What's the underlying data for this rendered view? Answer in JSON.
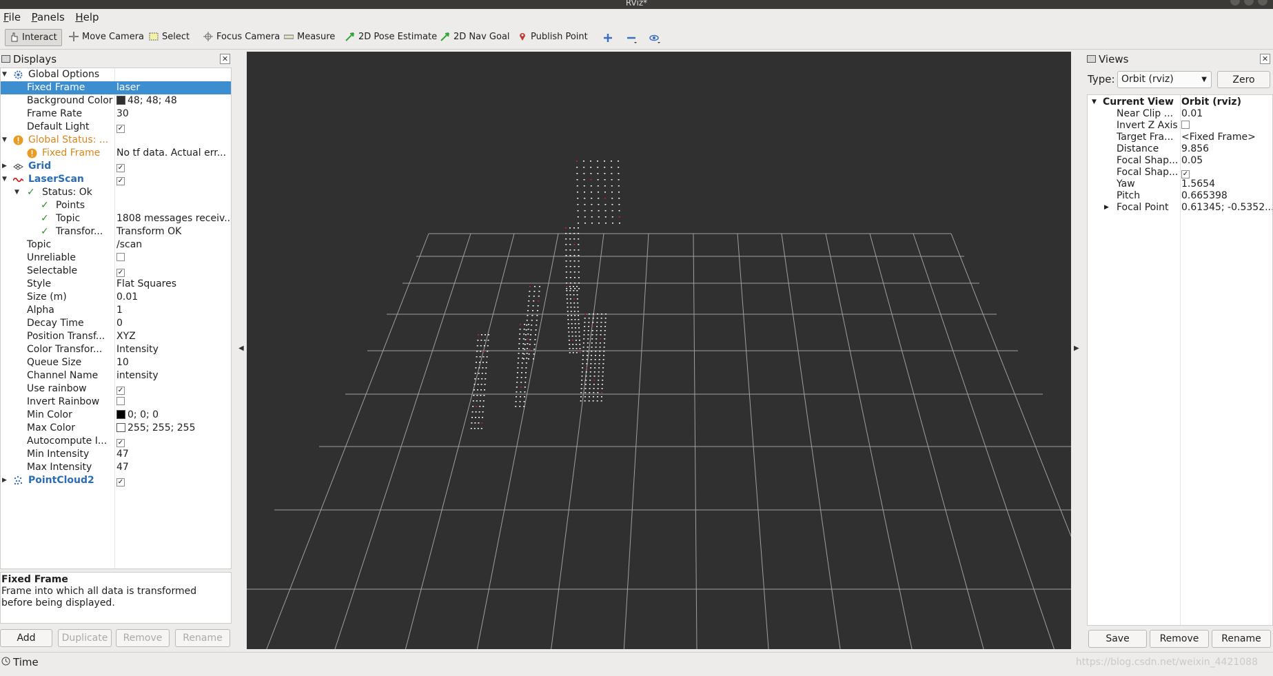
{
  "window": {
    "title": "RViz*"
  },
  "menu": [
    "File",
    "Panels",
    "Help"
  ],
  "toolbar": {
    "interact": "Interact",
    "move_camera": "Move Camera",
    "select": "Select",
    "focus_camera": "Focus Camera",
    "measure": "Measure",
    "pose_estimate": "2D Pose Estimate",
    "nav_goal": "2D Nav Goal",
    "publish_point": "Publish Point"
  },
  "displays": {
    "title": "Displays",
    "rows": {
      "global_options": "Global Options",
      "fixed_frame_k": "Fixed Frame",
      "fixed_frame_v": "laser",
      "bg_color_k": "Background Color",
      "bg_color_v": "48; 48; 48",
      "frame_rate_k": "Frame Rate",
      "frame_rate_v": "30",
      "default_light_k": "Default Light",
      "global_status_k": "Global Status: ...",
      "gs_fixed_frame_k": "Fixed Frame",
      "gs_fixed_frame_v": "No tf data.  Actual err...",
      "grid_k": "Grid",
      "laserscan_k": "LaserScan",
      "status_ok_k": "Status: Ok",
      "points_k": "Points",
      "topic_status_k": "Topic",
      "topic_status_v": "1808 messages receiv...",
      "transform_k": "Transfor...",
      "transform_v": "Transform OK",
      "topic_k": "Topic",
      "topic_v": "/scan",
      "unreliable_k": "Unreliable",
      "selectable_k": "Selectable",
      "style_k": "Style",
      "style_v": "Flat Squares",
      "size_k": "Size (m)",
      "size_v": "0.01",
      "alpha_k": "Alpha",
      "alpha_v": "1",
      "decay_k": "Decay Time",
      "decay_v": "0",
      "pos_transf_k": "Position Transf...",
      "pos_transf_v": "XYZ",
      "color_transf_k": "Color Transfor...",
      "color_transf_v": "Intensity",
      "queue_k": "Queue Size",
      "queue_v": "10",
      "channel_k": "Channel Name",
      "channel_v": "intensity",
      "use_rainbow_k": "Use rainbow",
      "invert_rainbow_k": "Invert Rainbow",
      "min_color_k": "Min Color",
      "min_color_v": "0; 0; 0",
      "max_color_k": "Max Color",
      "max_color_v": "255; 255; 255",
      "autocompute_k": "Autocompute I...",
      "min_int_k": "Min Intensity",
      "min_int_v": "47",
      "max_int_k": "Max Intensity",
      "max_int_v": "47",
      "pointcloud_k": "PointCloud2"
    },
    "description": {
      "title": "Fixed Frame",
      "text": "Frame into which all data is transformed before being displayed."
    },
    "buttons": {
      "add": "Add",
      "duplicate": "Duplicate",
      "remove": "Remove",
      "rename": "Rename"
    }
  },
  "views": {
    "title": "Views",
    "type_label": "Type:",
    "type_value": "Orbit (rviz)",
    "zero": "Zero",
    "current_view_k": "Current View",
    "current_view_v": "Orbit (rviz)",
    "props": [
      {
        "k": "Near Clip ...",
        "v": "0.01"
      },
      {
        "k": "Invert Z Axis",
        "v": ""
      },
      {
        "k": "Target Fra...",
        "v": "<Fixed Frame>"
      },
      {
        "k": "Distance",
        "v": "9.856"
      },
      {
        "k": "Focal Shap...",
        "v": "0.05"
      },
      {
        "k": "Focal Shap...",
        "v": ""
      },
      {
        "k": "Yaw",
        "v": "1.5654"
      },
      {
        "k": "Pitch",
        "v": "0.665398"
      },
      {
        "k": "Focal Point",
        "v": "0.61345; -0.5352..."
      }
    ],
    "buttons": {
      "save": "Save",
      "remove": "Remove",
      "rename": "Rename"
    }
  },
  "time_panel": {
    "title": "Time"
  },
  "watermark": "https://blog.csdn.net/weixin_4421088",
  "colors": {
    "background": "#303030",
    "selection": "#3d8ed1",
    "grid": "#a0a0a0",
    "points": "#ffffff",
    "highlight_points": "#e02020"
  }
}
